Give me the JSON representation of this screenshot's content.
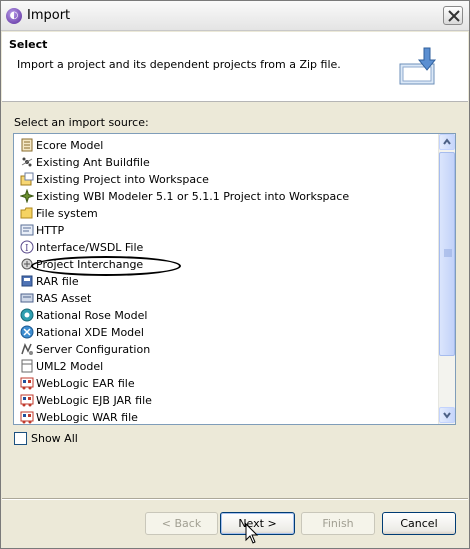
{
  "window": {
    "title": "Import"
  },
  "header": {
    "title": "Select",
    "description": "Import a project and its dependent projects from a Zip file."
  },
  "source_label": "Select an import source:",
  "sources": [
    {
      "label": "Ecore Model",
      "icon": "ecore-icon"
    },
    {
      "label": "Existing Ant Buildfile",
      "icon": "ant-icon"
    },
    {
      "label": "Existing Project into Workspace",
      "icon": "project-icon"
    },
    {
      "label": "Existing WBI Modeler 5.1 or 5.1.1 Project into Workspace",
      "icon": "wbi-icon"
    },
    {
      "label": "File system",
      "icon": "folder-icon"
    },
    {
      "label": "HTTP",
      "icon": "http-icon"
    },
    {
      "label": "Interface/WSDL File",
      "icon": "interface-icon"
    },
    {
      "label": "Project Interchange",
      "icon": "project-interchange-icon"
    },
    {
      "label": "RAR file",
      "icon": "rar-icon"
    },
    {
      "label": "RAS Asset",
      "icon": "ras-icon"
    },
    {
      "label": "Rational Rose Model",
      "icon": "rose-icon"
    },
    {
      "label": "Rational XDE Model",
      "icon": "xde-icon"
    },
    {
      "label": "Server Configuration",
      "icon": "server-icon"
    },
    {
      "label": "UML2 Model",
      "icon": "uml-icon"
    },
    {
      "label": "WebLogic EAR file",
      "icon": "weblogic-icon"
    },
    {
      "label": "WebLogic EJB JAR file",
      "icon": "weblogic-icon"
    },
    {
      "label": "WebLogic WAR file",
      "icon": "weblogic-icon"
    }
  ],
  "show_all": {
    "label": "Show All",
    "checked": false
  },
  "buttons": {
    "back": "< Back",
    "next": "Next >",
    "finish": "Finish",
    "cancel": "Cancel"
  }
}
